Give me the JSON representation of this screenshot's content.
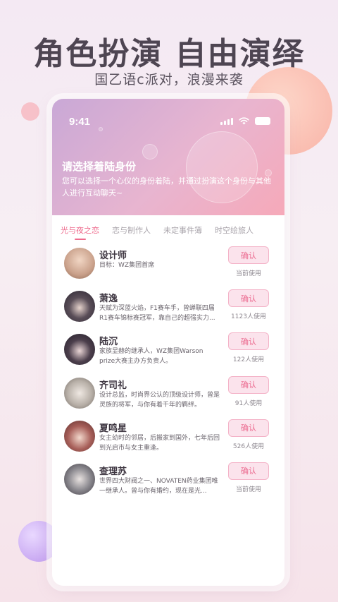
{
  "promo": {
    "title": "角色扮演 自由演绎",
    "subtitle": "国乙语c派对，浪漫来袭"
  },
  "status_bar": {
    "time": "9:41"
  },
  "header": {
    "title": "请选择着陆身份",
    "description": "您可以选择一个心仪的身份着陆，并通过扮演这个身份与其他人进行互动聊天~"
  },
  "tabs": [
    {
      "label": "光与夜之恋",
      "active": true
    },
    {
      "label": "恋与制作人",
      "active": false
    },
    {
      "label": "未定事件簿",
      "active": false
    },
    {
      "label": "时空绘旅人",
      "active": false
    }
  ],
  "characters": [
    {
      "name": "设计师",
      "description": "目标：WZ集团首席",
      "button": "确认",
      "usage": "当前使用",
      "avatar_color": "#c9a08a"
    },
    {
      "name": "萧逸",
      "description": "天赋为深蓝火焰，F1赛车手，曾蝉联四届R1赛车锦标赛冠军，靠自己的超强实力...",
      "button": "确认",
      "usage": "1123人使用",
      "avatar_color": "#3a3340"
    },
    {
      "name": "陆沉",
      "description": "家族显赫的继承人，WZ集团Warson prize大赛主办方负责人。",
      "button": "确认",
      "usage": "122人使用",
      "avatar_color": "#2f2a36"
    },
    {
      "name": "齐司礼",
      "description": "设计总监，时尚界公认的顶级设计师，曾是灵族的将军，与你有着千年的羁绊。",
      "button": "确认",
      "usage": "91人使用",
      "avatar_color": "#b8b0a8"
    },
    {
      "name": "夏鸣星",
      "description": "女主幼时的邻居，后搬家到国外，七年后回到光启市与女主重逢。",
      "button": "确认",
      "usage": "526人使用",
      "avatar_color": "#8a5048"
    },
    {
      "name": "查理苏",
      "description": "世界四大财阀之一、NOVATEN药业集团唯一继承人。曾与你有婚约，现在是光...",
      "button": "确认",
      "usage": "当前使用",
      "avatar_color": "#8c8a90"
    }
  ]
}
